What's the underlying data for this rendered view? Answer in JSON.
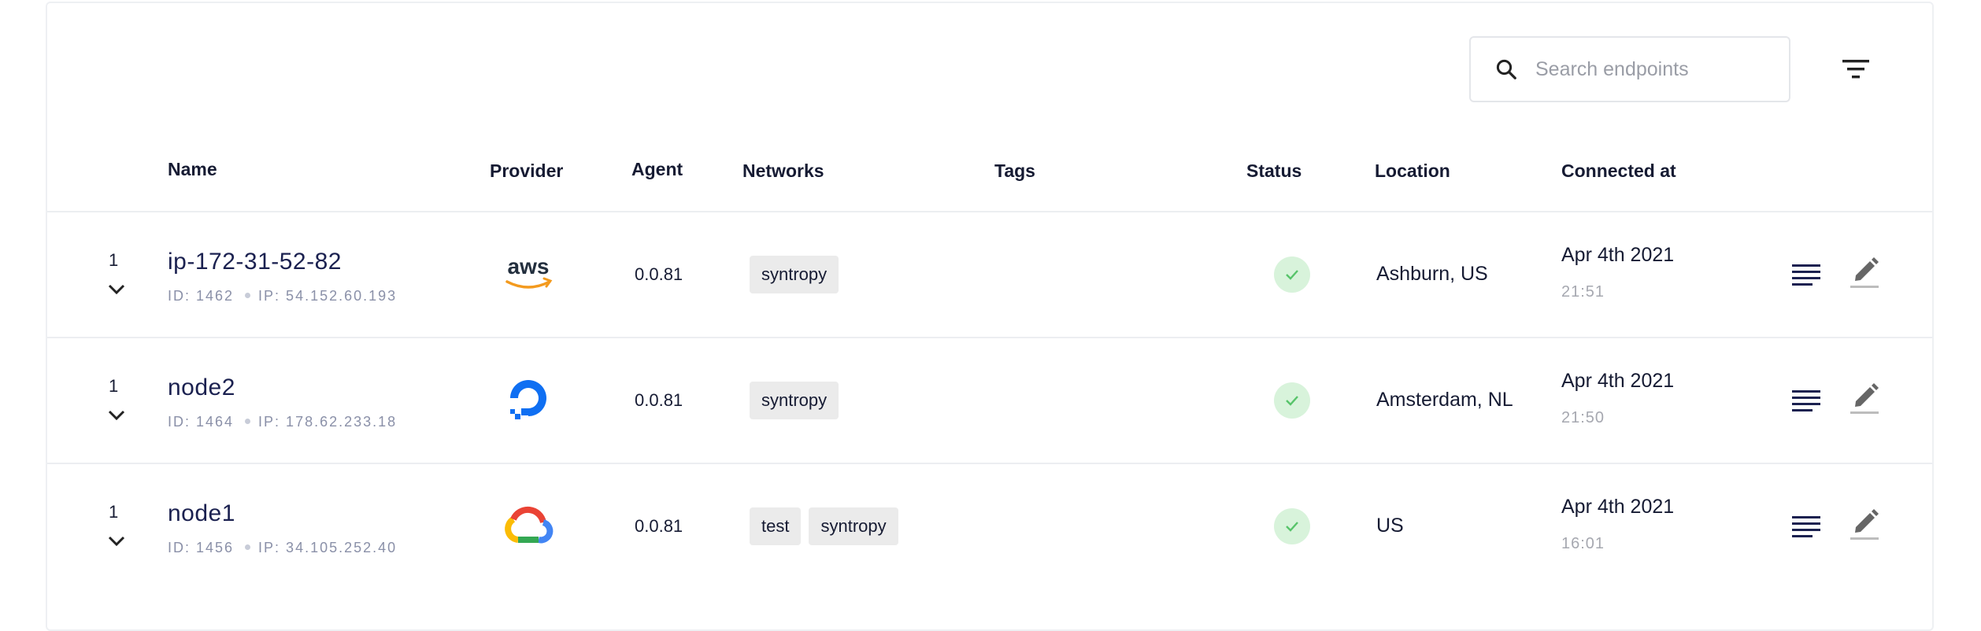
{
  "search": {
    "placeholder": "Search endpoints",
    "value": ""
  },
  "table": {
    "headers": {
      "name": "Name",
      "provider": "Provider",
      "agent": "Agent",
      "networks": "Networks",
      "tags": "Tags",
      "status": "Status",
      "location": "Location",
      "connected_at": "Connected at"
    },
    "rows": [
      {
        "count": "1",
        "name": "ip-172-31-52-82",
        "id": "ID: 1462",
        "ip": "IP: 54.152.60.193",
        "provider_icon": "aws-logo",
        "agent": "0.0.81",
        "networks": [
          "syntropy"
        ],
        "status": "connected",
        "location": "Ashburn, US",
        "date": "Apr 4th 2021",
        "time": "21:51"
      },
      {
        "count": "1",
        "name": "node2",
        "id": "ID: 1464",
        "ip": "IP: 178.62.233.18",
        "provider_icon": "digitalocean-logo",
        "agent": "0.0.81",
        "networks": [
          "syntropy"
        ],
        "status": "connected",
        "location": "Amsterdam, NL",
        "date": "Apr 4th 2021",
        "time": "21:50"
      },
      {
        "count": "1",
        "name": "node1",
        "id": "ID: 1456",
        "ip": "IP: 34.105.252.40",
        "provider_icon": "google-cloud-logo",
        "agent": "0.0.81",
        "networks": [
          "test",
          "syntropy"
        ],
        "status": "connected",
        "location": "US",
        "date": "Apr 4th 2021",
        "time": "16:01"
      }
    ]
  },
  "colors": {
    "status_ok_bg": "#d8f3db",
    "status_ok_check": "#57c46a",
    "tag_bg": "#ebebeb",
    "name_text": "#1b2150"
  }
}
